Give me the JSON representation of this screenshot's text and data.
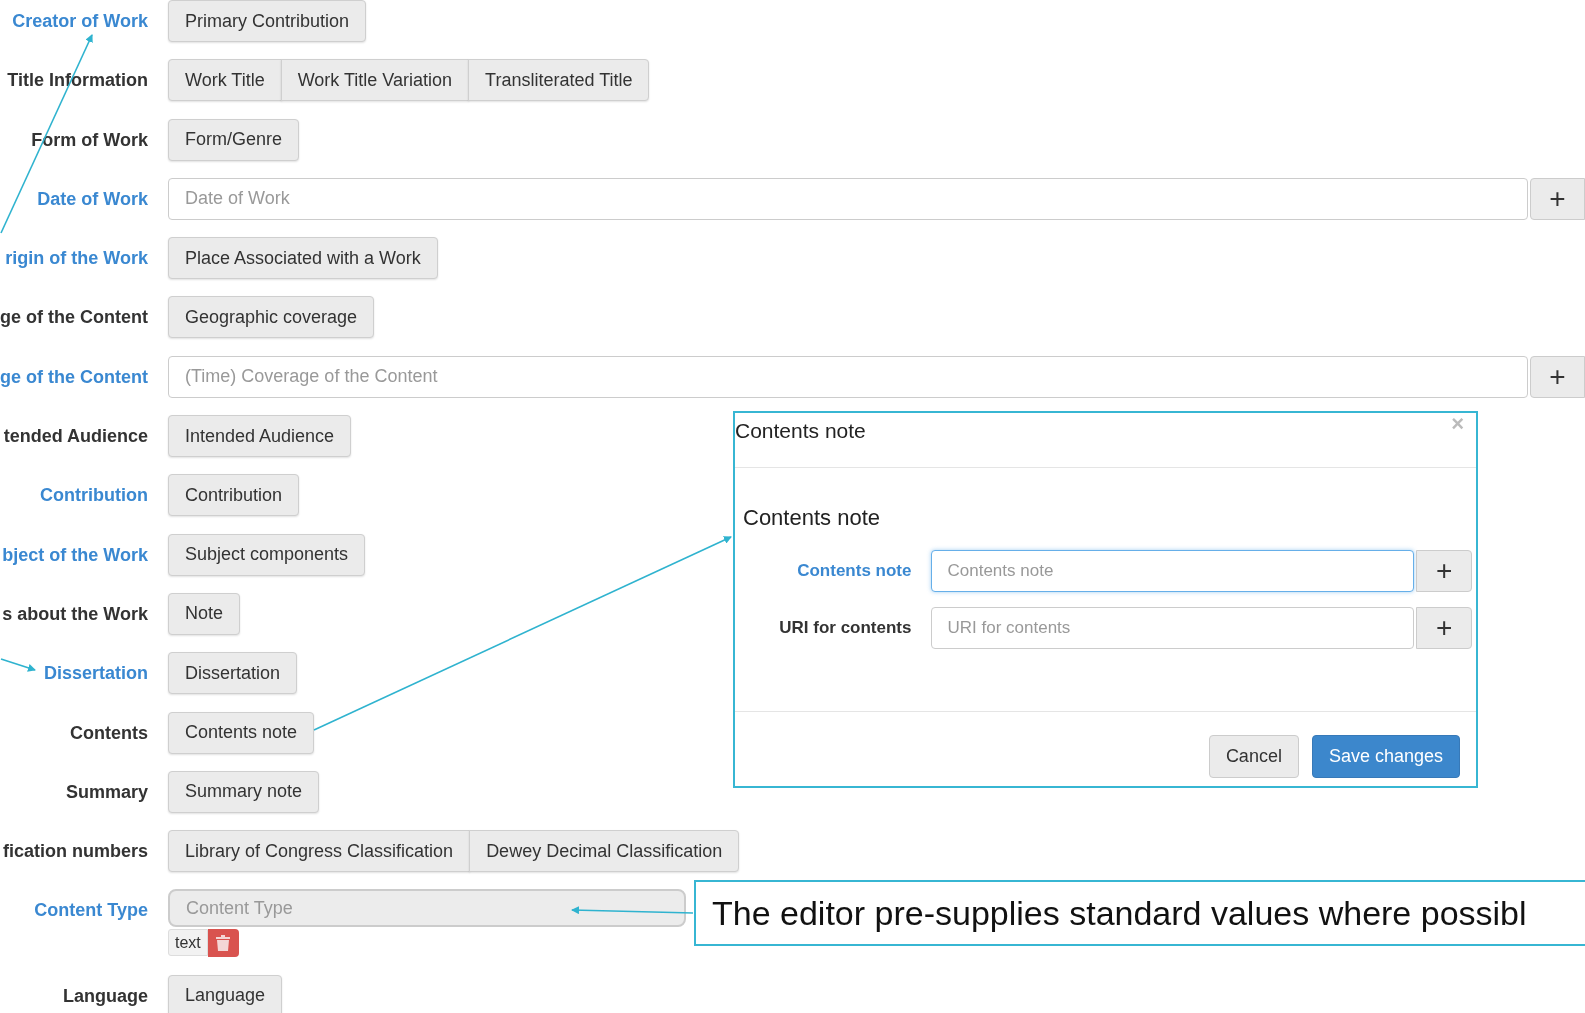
{
  "form": {
    "rows": [
      {
        "label": "Creator of Work",
        "highlighted": true,
        "kind": "buttons",
        "buttons": [
          "Primary Contribution"
        ]
      },
      {
        "label": "Title Information",
        "highlighted": false,
        "kind": "buttons",
        "buttons": [
          "Work Title",
          "Work Title Variation",
          "Transliterated Title"
        ]
      },
      {
        "label": "Form of Work",
        "highlighted": false,
        "kind": "buttons",
        "buttons": [
          "Form/Genre"
        ]
      },
      {
        "label": "Date of Work",
        "highlighted": true,
        "kind": "input",
        "placeholder": "Date of Work",
        "add_button": "+"
      },
      {
        "label": "rigin of the Work",
        "highlighted": true,
        "kind": "buttons",
        "buttons": [
          "Place Associated with a Work"
        ]
      },
      {
        "label": "ge of the Content",
        "highlighted": false,
        "kind": "buttons",
        "buttons": [
          "Geographic coverage"
        ]
      },
      {
        "label": "ge of the Content",
        "highlighted": true,
        "kind": "input",
        "placeholder": "(Time) Coverage of the Content",
        "add_button": "+"
      },
      {
        "label": "tended Audience",
        "highlighted": false,
        "kind": "buttons",
        "buttons": [
          "Intended Audience"
        ]
      },
      {
        "label": "Contribution",
        "highlighted": true,
        "kind": "buttons",
        "buttons": [
          "Contribution"
        ]
      },
      {
        "label": "bject of the Work",
        "highlighted": true,
        "kind": "buttons",
        "buttons": [
          "Subject components"
        ]
      },
      {
        "label": "s about the Work",
        "highlighted": false,
        "kind": "buttons",
        "buttons": [
          "Note"
        ]
      },
      {
        "label": "Dissertation",
        "highlighted": true,
        "kind": "buttons",
        "buttons": [
          "Dissertation"
        ]
      },
      {
        "label": "Contents",
        "highlighted": false,
        "kind": "buttons",
        "buttons": [
          "Contents note"
        ]
      },
      {
        "label": "Summary",
        "highlighted": false,
        "kind": "buttons",
        "buttons": [
          "Summary note"
        ]
      },
      {
        "label": "fication numbers",
        "highlighted": false,
        "kind": "buttons",
        "buttons": [
          "Library of Congress Classification",
          "Dewey Decimal Classification"
        ]
      },
      {
        "label": "Content Type",
        "highlighted": true,
        "kind": "select",
        "placeholder": "Content Type",
        "tags": [
          {
            "label": "text"
          }
        ]
      },
      {
        "label": "Language",
        "highlighted": false,
        "kind": "buttons",
        "buttons": [
          "Language"
        ]
      }
    ]
  },
  "modal": {
    "title": "Contents note",
    "close": "×",
    "heading": "Contents note",
    "fields": [
      {
        "label": "Contents note",
        "highlighted": true,
        "placeholder": "Contents note",
        "focused": true,
        "add_button": "+"
      },
      {
        "label": "URI for contents",
        "highlighted": false,
        "placeholder": "URI for contents",
        "focused": false,
        "add_button": "+"
      }
    ],
    "buttons": [
      {
        "label": "Cancel",
        "primary": false
      },
      {
        "label": "Save changes",
        "primary": true
      }
    ]
  },
  "callout": {
    "text": "The editor pre-supplies standard values where possibl"
  }
}
